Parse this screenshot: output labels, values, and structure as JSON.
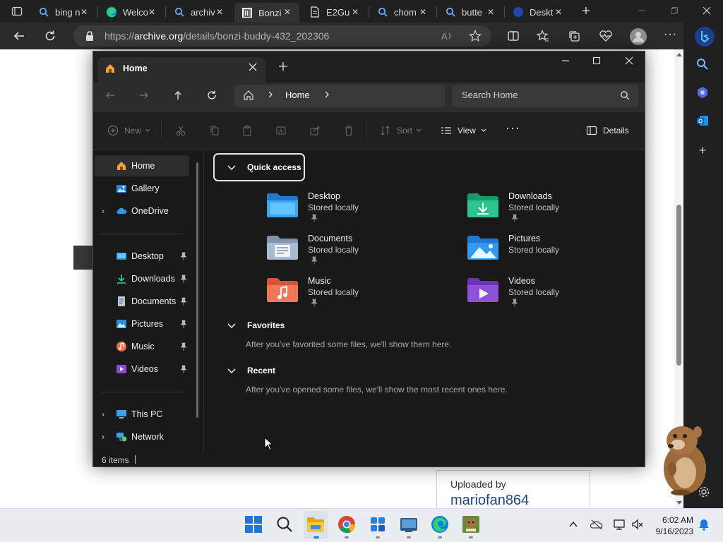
{
  "browser": {
    "tabs": [
      {
        "label": "bing n",
        "icon": "search-icon"
      },
      {
        "label": "Welco",
        "icon": "edge-icon"
      },
      {
        "label": "archiv",
        "icon": "search-icon"
      },
      {
        "label": "Bonzi",
        "icon": "archive-org-icon"
      },
      {
        "label": "E2Gu",
        "icon": "document-icon"
      },
      {
        "label": "chom",
        "icon": "search-icon"
      },
      {
        "label": "butte",
        "icon": "search-icon"
      },
      {
        "label": "Deskt",
        "icon": "tab-favicon"
      }
    ],
    "active_tab_index": 3,
    "url_prefix": "https://",
    "url_host": "archive.org",
    "url_path": "/details/bonzi-buddy-432_202306"
  },
  "webpage": {
    "uploaded_label": "Uploaded by",
    "uploader": "mariofan864"
  },
  "explorer": {
    "tab_title": "Home",
    "breadcrumb": "Home",
    "search_placeholder": "Search Home",
    "toolbar": {
      "new_label": "New",
      "sort_label": "Sort",
      "view_label": "View",
      "details_label": "Details"
    },
    "nav": {
      "home": "Home",
      "gallery": "Gallery",
      "onedrive": "OneDrive",
      "desktop": "Desktop",
      "downloads": "Downloads",
      "documents": "Documents",
      "pictures": "Pictures",
      "music": "Music",
      "videos": "Videos",
      "this_pc": "This PC",
      "network": "Network"
    },
    "quick_access": {
      "title": "Quick access",
      "items": [
        {
          "name": "Desktop",
          "sub": "Stored locally",
          "icon": "desktop-folder-icon"
        },
        {
          "name": "Downloads",
          "sub": "Stored locally",
          "icon": "downloads-folder-icon"
        },
        {
          "name": "Documents",
          "sub": "Stored locally",
          "icon": "documents-folder-icon"
        },
        {
          "name": "Pictures",
          "sub": "Stored locally",
          "icon": "pictures-folder-icon"
        },
        {
          "name": "Music",
          "sub": "Stored locally",
          "icon": "music-folder-icon"
        },
        {
          "name": "Videos",
          "sub": "Stored locally",
          "icon": "videos-folder-icon"
        }
      ]
    },
    "favorites": {
      "title": "Favorites",
      "empty_text": "After you've favorited some files, we'll show them here."
    },
    "recent": {
      "title": "Recent",
      "empty_text": "After you've opened some files, we'll show the most recent ones here."
    },
    "status": "6 items"
  },
  "taskbar": {
    "time": "6:02 AM",
    "date": "9/16/2023"
  },
  "colors": {
    "explorer_bg": "#191919",
    "accent_blue": "#0078d4",
    "taskbar_bg": "#e9edf2"
  }
}
